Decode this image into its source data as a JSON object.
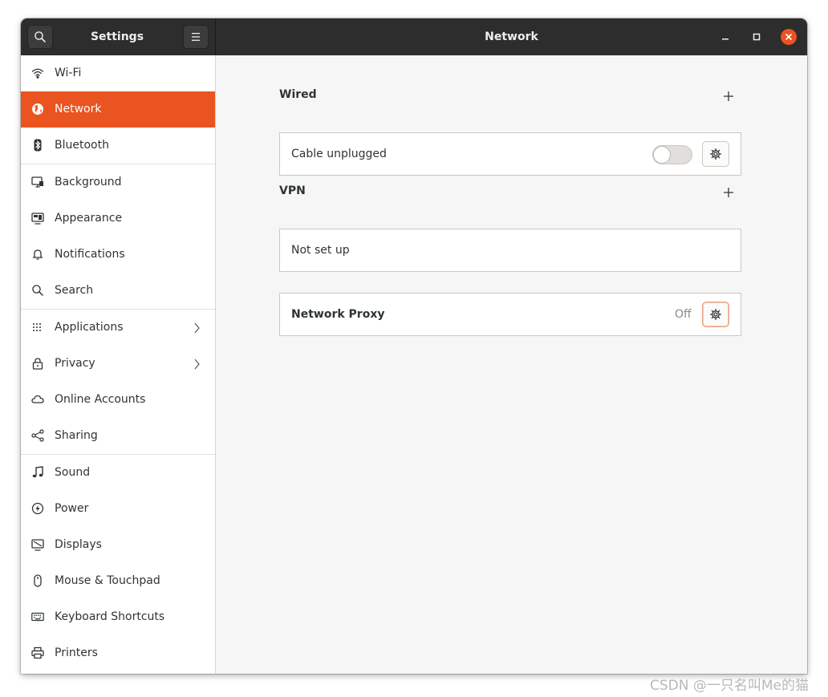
{
  "titlebar": {
    "app_title": "Settings",
    "page_title": "Network"
  },
  "sidebar": {
    "items": [
      {
        "label": "Wi-Fi"
      },
      {
        "label": "Network",
        "active": true
      },
      {
        "label": "Bluetooth"
      },
      {
        "label": "Background"
      },
      {
        "label": "Appearance"
      },
      {
        "label": "Notifications"
      },
      {
        "label": "Search"
      },
      {
        "label": "Applications",
        "has_submenu": true
      },
      {
        "label": "Privacy",
        "has_submenu": true
      },
      {
        "label": "Online Accounts"
      },
      {
        "label": "Sharing"
      },
      {
        "label": "Sound"
      },
      {
        "label": "Power"
      },
      {
        "label": "Displays"
      },
      {
        "label": "Mouse & Touchpad"
      },
      {
        "label": "Keyboard Shortcuts"
      },
      {
        "label": "Printers"
      }
    ]
  },
  "main": {
    "wired": {
      "title": "Wired",
      "row_label": "Cable unplugged",
      "switch_on": false
    },
    "vpn": {
      "title": "VPN",
      "row_label": "Not set up"
    },
    "proxy": {
      "label": "Network Proxy",
      "status": "Off"
    }
  },
  "watermark": "CSDN @一只名叫Me的猫",
  "colors": {
    "accent": "#e95420",
    "titlebar": "#2d2d2d",
    "sidebar_bg": "#ffffff",
    "content_bg": "#f6f6f6"
  },
  "icons": {
    "search": "search-icon",
    "menu": "hamburger-menu-icon",
    "minimize": "minimize-icon",
    "maximize": "maximize-icon",
    "close": "close-icon",
    "wifi": "wifi-icon",
    "network": "globe-icon",
    "bluetooth": "bluetooth-icon",
    "background": "background-icon",
    "appearance": "appearance-icon",
    "notifications": "bell-icon",
    "search_item": "search-icon",
    "applications": "apps-grid-icon",
    "privacy": "lock-icon",
    "online_accounts": "cloud-icon",
    "sharing": "share-icon",
    "sound": "music-note-icon",
    "power": "power-icon",
    "displays": "display-icon",
    "mouse": "mouse-icon",
    "keyboard": "keyboard-icon",
    "printers": "printer-icon",
    "add": "plus-icon",
    "settings": "gear-icon"
  }
}
